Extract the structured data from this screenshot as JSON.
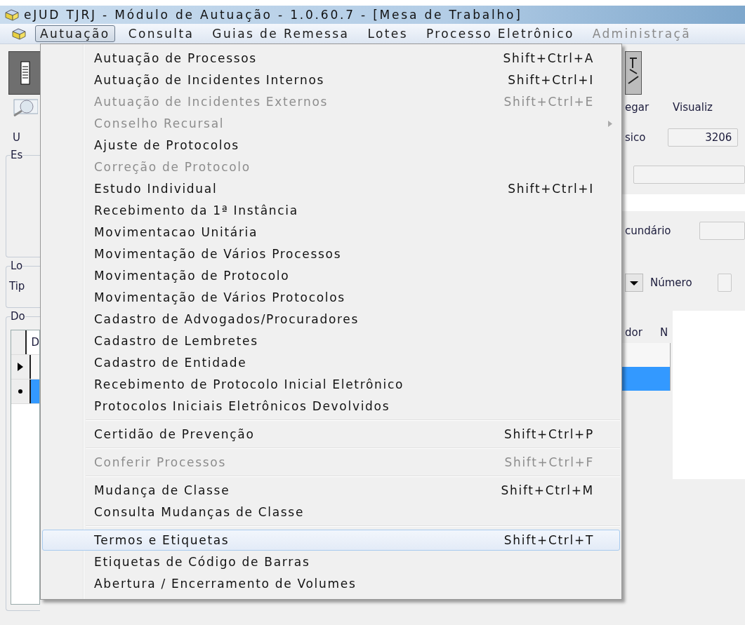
{
  "window": {
    "title": "eJUD TJRJ - Módulo de Autuação - 1.0.60.7 - [Mesa de Trabalho]"
  },
  "menu_bar": [
    {
      "label": "Autuação",
      "selected": true,
      "disabled": false
    },
    {
      "label": "Consulta",
      "selected": false,
      "disabled": false
    },
    {
      "label": "Guias de Remessa",
      "selected": false,
      "disabled": false
    },
    {
      "label": "Lotes",
      "selected": false,
      "disabled": false
    },
    {
      "label": "Processo Eletrônico",
      "selected": false,
      "disabled": false
    },
    {
      "label": "Administraçã",
      "selected": false,
      "disabled": true
    }
  ],
  "dropdown": {
    "items": [
      {
        "kind": "item",
        "label": "Autuação de Processos",
        "shortcut": "Shift+Ctrl+A",
        "disabled": false,
        "submenu": false,
        "highlighted": false
      },
      {
        "kind": "item",
        "label": "Autuação de Incidentes Internos",
        "shortcut": "Shift+Ctrl+I",
        "disabled": false,
        "submenu": false,
        "highlighted": false
      },
      {
        "kind": "item",
        "label": "Autuação de Incidentes Externos",
        "shortcut": "Shift+Ctrl+E",
        "disabled": true,
        "submenu": false,
        "highlighted": false
      },
      {
        "kind": "item",
        "label": "Conselho Recursal",
        "disabled": true,
        "submenu": true,
        "highlighted": false
      },
      {
        "kind": "item",
        "label": "Ajuste de Protocolos",
        "disabled": false,
        "submenu": false,
        "highlighted": false
      },
      {
        "kind": "item",
        "label": "Correção de Protocolo",
        "disabled": true,
        "submenu": false,
        "highlighted": false
      },
      {
        "kind": "item",
        "label": "Estudo Individual",
        "shortcut": "Shift+Ctrl+I",
        "disabled": false,
        "submenu": false,
        "highlighted": false
      },
      {
        "kind": "item",
        "label": "Recebimento da 1ª Instância",
        "disabled": false,
        "submenu": false,
        "highlighted": false
      },
      {
        "kind": "item",
        "label": "Movimentacao Unitária",
        "disabled": false,
        "submenu": false,
        "highlighted": false
      },
      {
        "kind": "item",
        "label": "Movimentação de Vários Processos",
        "disabled": false,
        "submenu": false,
        "highlighted": false
      },
      {
        "kind": "item",
        "label": "Movimentação de Protocolo",
        "disabled": false,
        "submenu": false,
        "highlighted": false
      },
      {
        "kind": "item",
        "label": "Movimentação de Vários Protocolos",
        "disabled": false,
        "submenu": false,
        "highlighted": false
      },
      {
        "kind": "item",
        "label": "Cadastro de Advogados/Procuradores",
        "disabled": false,
        "submenu": false,
        "highlighted": false
      },
      {
        "kind": "item",
        "label": "Cadastro de Lembretes",
        "disabled": false,
        "submenu": false,
        "highlighted": false
      },
      {
        "kind": "item",
        "label": "Cadastro de Entidade",
        "disabled": false,
        "submenu": false,
        "highlighted": false
      },
      {
        "kind": "item",
        "label": "Recebimento de Protocolo Inicial Eletrônico",
        "disabled": false,
        "submenu": false,
        "highlighted": false
      },
      {
        "kind": "item",
        "label": "Protocolos Iniciais Eletrônicos Devolvidos",
        "disabled": false,
        "submenu": false,
        "highlighted": false
      },
      {
        "kind": "separator"
      },
      {
        "kind": "item",
        "label": "Certidão de Prevenção",
        "shortcut": "Shift+Ctrl+P",
        "disabled": false,
        "submenu": false,
        "highlighted": false
      },
      {
        "kind": "separator"
      },
      {
        "kind": "item",
        "label": "Conferir Processos",
        "shortcut": "Shift+Ctrl+F",
        "disabled": true,
        "submenu": false,
        "highlighted": false
      },
      {
        "kind": "separator"
      },
      {
        "kind": "item",
        "label": "Mudança de Classe",
        "shortcut": "Shift+Ctrl+M",
        "disabled": false,
        "submenu": false,
        "highlighted": false
      },
      {
        "kind": "item",
        "label": "Consulta Mudanças de Classe",
        "disabled": false,
        "submenu": false,
        "highlighted": false
      },
      {
        "kind": "separator"
      },
      {
        "kind": "item",
        "label": "Termos e Etiquetas",
        "shortcut": "Shift+Ctrl+T",
        "disabled": false,
        "submenu": false,
        "highlighted": true
      },
      {
        "kind": "item",
        "label": "Etiquetas de Código de Barras",
        "disabled": false,
        "submenu": false,
        "highlighted": false
      },
      {
        "kind": "item",
        "label": "Abertura / Encerramento de Volumes",
        "disabled": false,
        "submenu": false,
        "highlighted": false
      }
    ]
  },
  "background": {
    "left": {
      "label_1": "U",
      "group_1": "Es",
      "group_2": "Lo",
      "label_2": "Tip",
      "group_3": "Do",
      "grid_header": "D"
    },
    "right": {
      "link_1": "egar",
      "link_2": "Visualiz",
      "label_1": "sico",
      "field_1": "3206",
      "label_2": "cundário",
      "label_3": "Número",
      "grid_header_1": "dor",
      "grid_header_2": "N"
    },
    "grid_rows": [
      {
        "current": true,
        "selected": false
      },
      {
        "current": false,
        "selected": true
      }
    ]
  }
}
